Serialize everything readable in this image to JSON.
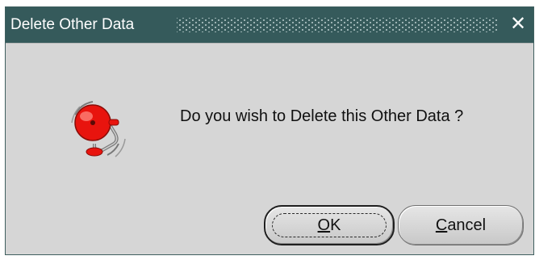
{
  "dialog": {
    "title": "Delete Other Data",
    "close_glyph": "✕",
    "icon": "alarm-bell-icon",
    "message": "Do you wish to Delete this Other Data ?"
  },
  "buttons": {
    "ok": {
      "mnemonic": "O",
      "rest": "K"
    },
    "cancel": {
      "mnemonic": "C",
      "rest": "ancel"
    }
  },
  "colors": {
    "titlebar": "#355a5b",
    "dialog_bg": "#d6d6d6",
    "alarm_red": "#e8140e"
  }
}
